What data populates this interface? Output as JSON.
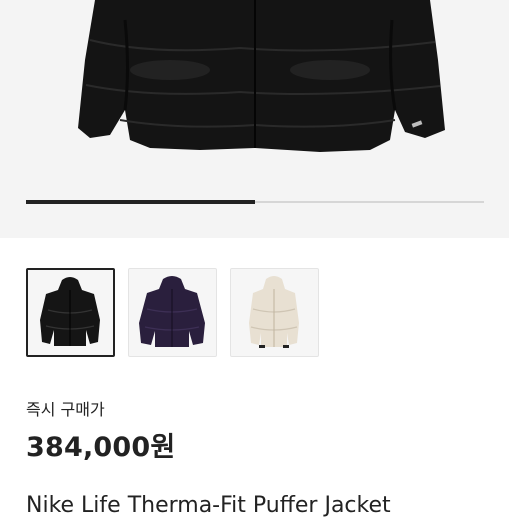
{
  "hero": {
    "image": "black-puffer-jacket-image",
    "progress_fraction": 0.5
  },
  "thumbnails": [
    {
      "image": "black-puffer-jacket-thumb",
      "selected": true
    },
    {
      "image": "purple-puffer-jacket-thumb",
      "selected": false
    },
    {
      "image": "cream-puffer-jacket-thumb",
      "selected": false
    }
  ],
  "price_section": {
    "label": "즉시 구매가",
    "price": "384,000원"
  },
  "product": {
    "name": "Nike Life Therma-Fit Puffer Jacket"
  },
  "colors": {
    "hero_bg": "#f4f4f4",
    "text": "#222222",
    "progress_track": "#d6d6d6",
    "progress_fill": "#222222"
  }
}
